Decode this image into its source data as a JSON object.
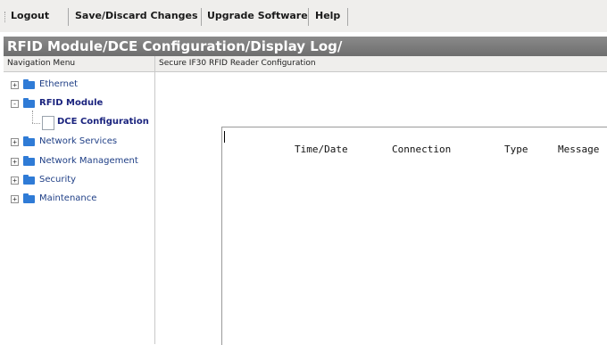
{
  "menu": {
    "logout": "Logout",
    "save_discard": "Save/Discard Changes",
    "upgrade": "Upgrade Software",
    "help": "Help"
  },
  "title": "RFID Module/DCE Configuration/Display Log/",
  "nav": {
    "header": "Navigation Menu",
    "items": [
      {
        "label": "Ethernet",
        "expander": "+"
      },
      {
        "label": "RFID Module",
        "expander": "-"
      },
      {
        "label": "DCE Configuration"
      },
      {
        "label": "Network Services",
        "expander": "+"
      },
      {
        "label": "Network Management",
        "expander": "+"
      },
      {
        "label": "Security",
        "expander": "+"
      },
      {
        "label": "Maintenance",
        "expander": "+"
      }
    ]
  },
  "main": {
    "header": "Secure IF30 RFID Reader Configuration",
    "log_columns": [
      "Time/Date",
      "Connection",
      "Type",
      "Message"
    ]
  }
}
